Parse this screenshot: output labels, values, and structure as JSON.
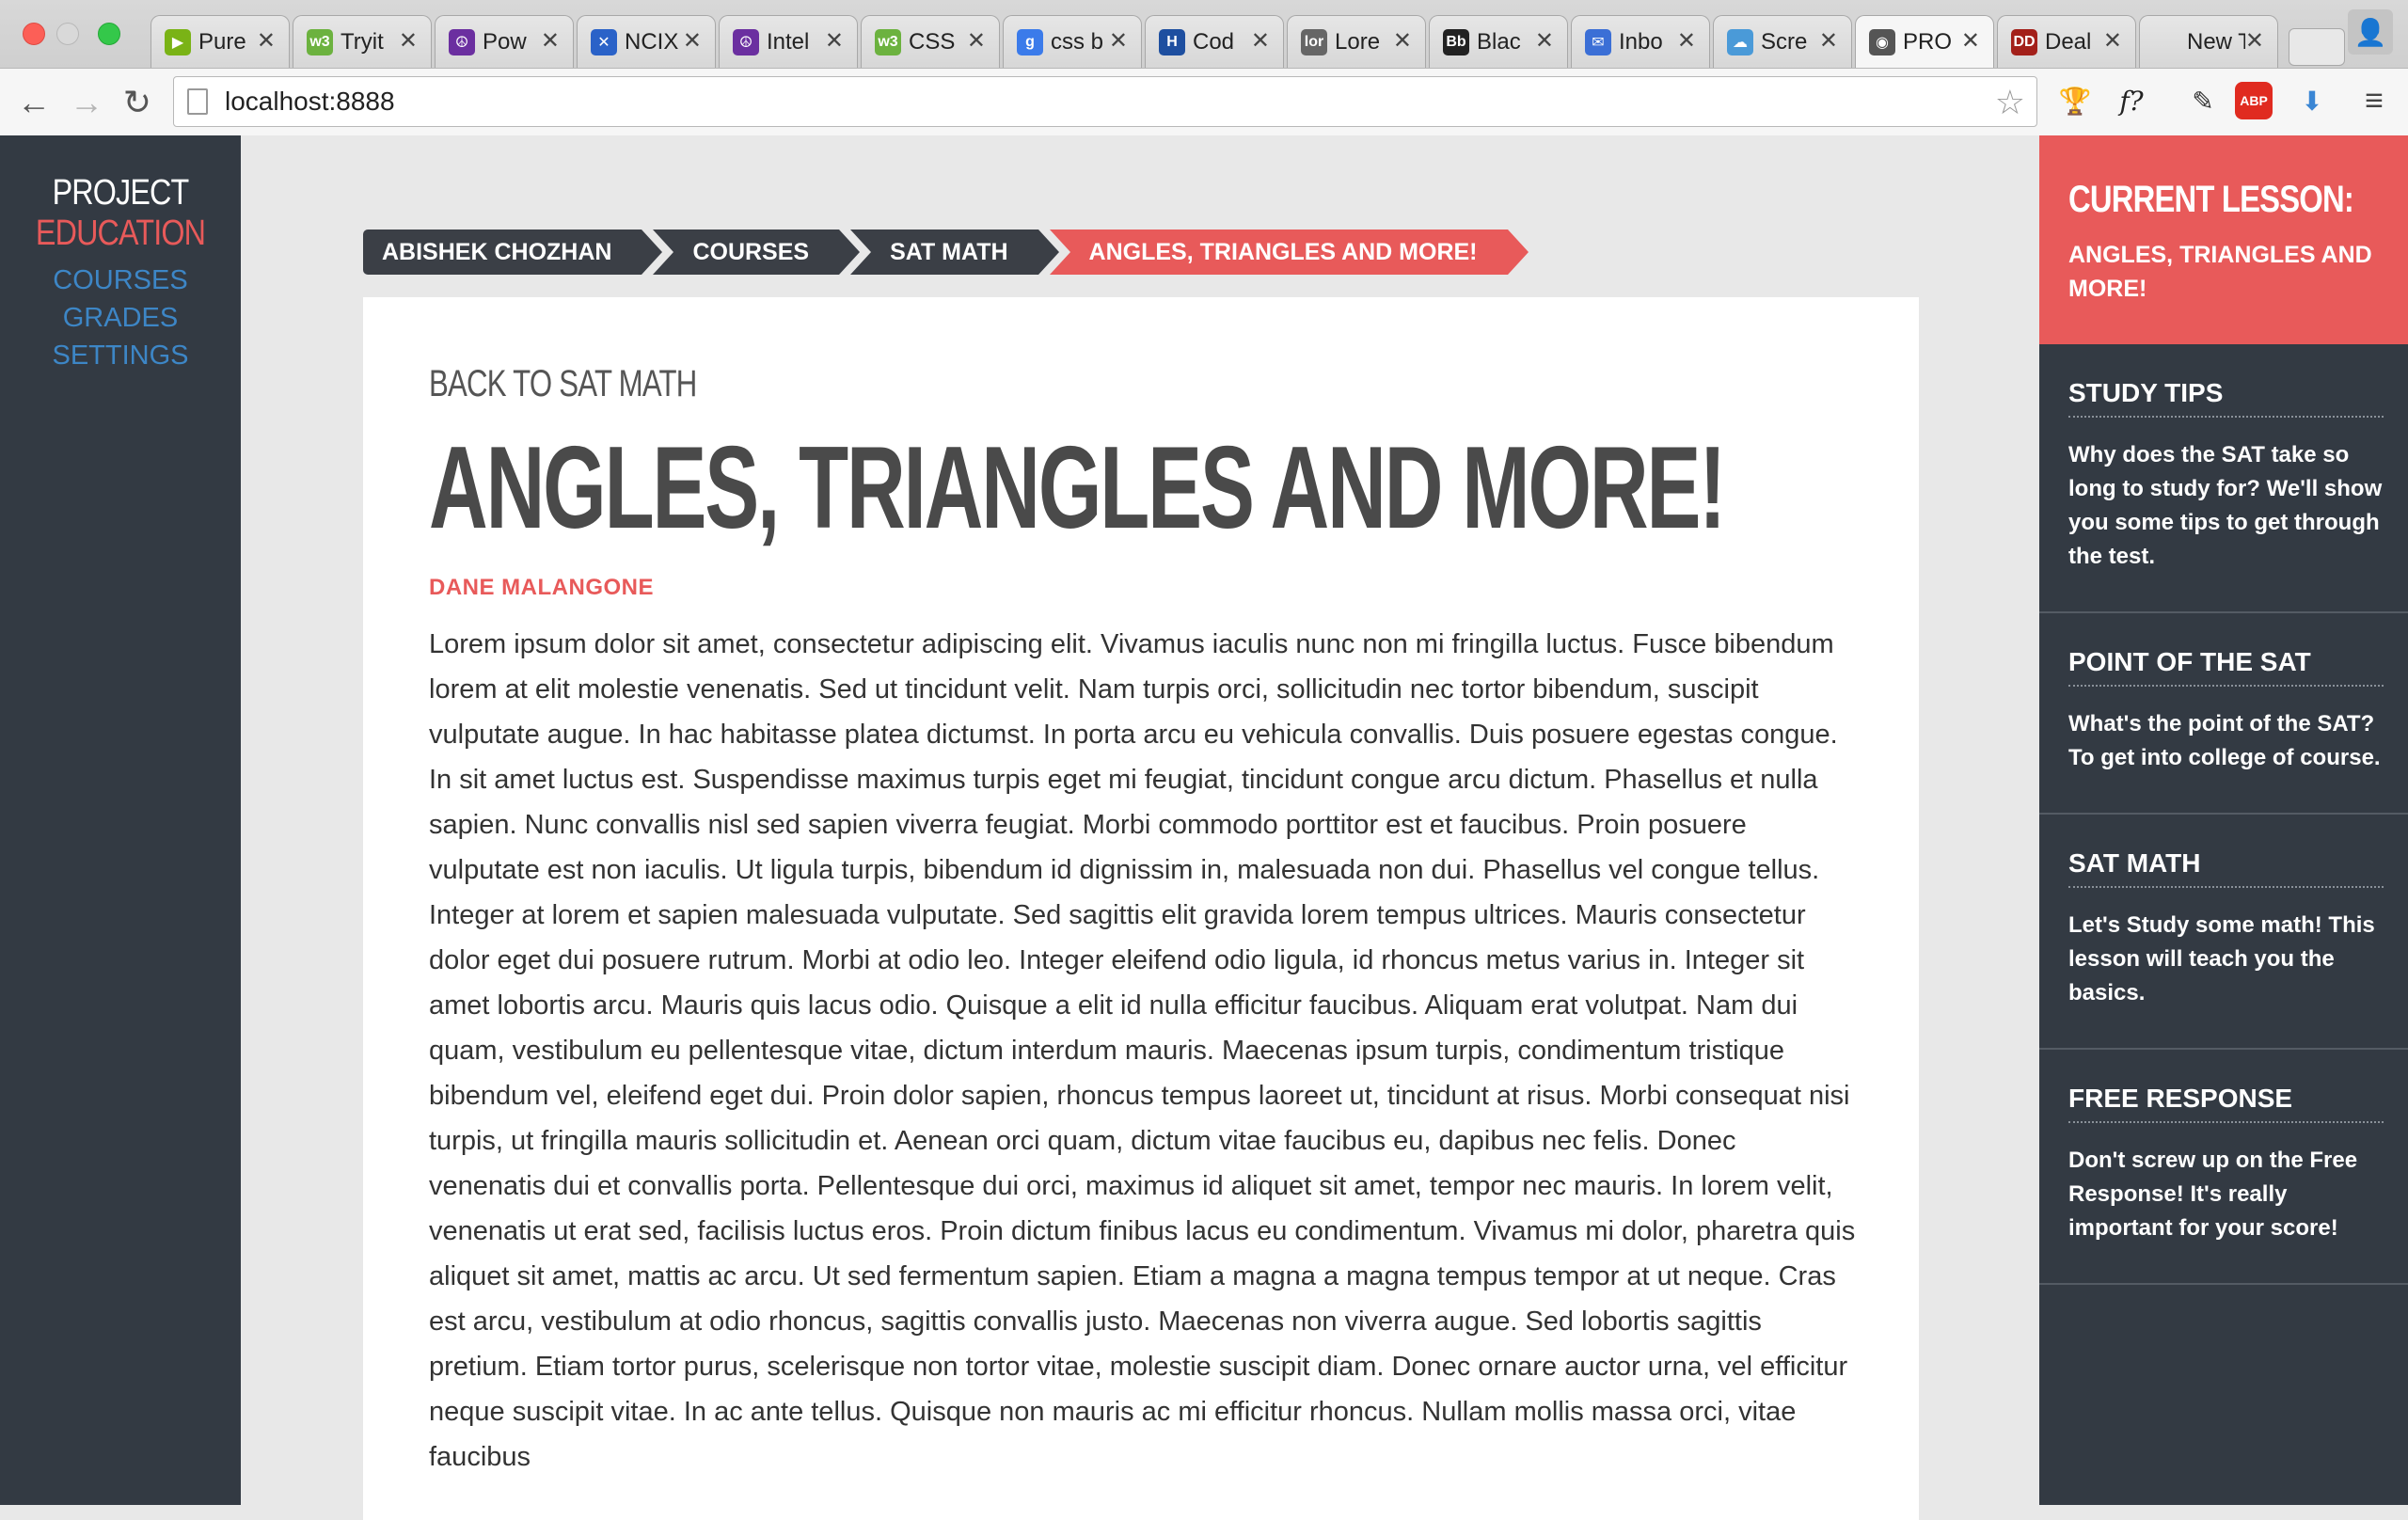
{
  "browser": {
    "tabs": [
      {
        "title": "Pure",
        "fav_text": "▶",
        "fav_color": "#7ab316"
      },
      {
        "title": "Tryit",
        "fav_text": "w3",
        "fav_color": "#6cb23f"
      },
      {
        "title": "Pow",
        "fav_text": "☮",
        "fav_color": "#6b2fa0"
      },
      {
        "title": "NCIX",
        "fav_text": "✕",
        "fav_color": "#2a62c8"
      },
      {
        "title": "Intel",
        "fav_text": "☮",
        "fav_color": "#6b2fa0"
      },
      {
        "title": "CSS",
        "fav_text": "w3",
        "fav_color": "#6cb23f"
      },
      {
        "title": "css b",
        "fav_text": "g",
        "fav_color": "#3b7bea"
      },
      {
        "title": "Cod",
        "fav_text": "H",
        "fav_color": "#1e4fa0"
      },
      {
        "title": "Lore",
        "fav_text": "lor",
        "fav_color": "#666666"
      },
      {
        "title": "Blac",
        "fav_text": "Bb",
        "fav_color": "#222222"
      },
      {
        "title": "Inbo",
        "fav_text": "✉",
        "fav_color": "#3b6fd6"
      },
      {
        "title": "Scre",
        "fav_text": "☁",
        "fav_color": "#4a9ad8"
      },
      {
        "title": "PRO",
        "fav_text": "◉",
        "fav_color": "#555555"
      },
      {
        "title": "Deal",
        "fav_text": "DD",
        "fav_color": "#a3201a"
      },
      {
        "title": "New Ta",
        "fav_text": "",
        "fav_color": "transparent"
      }
    ],
    "tab_close": "✕",
    "url": "localhost:8888",
    "active_tab_index": 12
  },
  "nav": {
    "logo_line1": "PROJECT",
    "logo_line2": "EDUCATION",
    "links": [
      "COURSES",
      "GRADES",
      "SETTINGS"
    ]
  },
  "breadcrumb": [
    "ABISHEK CHOZHAN",
    "COURSES",
    "SAT MATH",
    "ANGLES, TRIANGLES AND MORE!"
  ],
  "lesson": {
    "back_link": "BACK TO SAT MATH",
    "title": "ANGLES, TRIANGLES AND MORE!",
    "author": "DANE MALANGONE",
    "body": "Lorem ipsum dolor sit amet, consectetur adipiscing elit. Vivamus iaculis nunc non mi fringilla luctus. Fusce bibendum lorem at elit molestie venenatis. Sed ut tincidunt velit. Nam turpis orci, sollicitudin nec tortor bibendum, suscipit vulputate augue. In hac habitasse platea dictumst. In porta arcu eu vehicula convallis. Duis posuere egestas congue. In sit amet luctus est. Suspendisse maximus turpis eget mi feugiat, tincidunt congue arcu dictum. Phasellus et nulla sapien. Nunc convallis nisl sed sapien viverra feugiat. Morbi commodo porttitor est et faucibus. Proin posuere vulputate est non iaculis. Ut ligula turpis, bibendum id dignissim in, malesuada non dui. Phasellus vel congue tellus. Integer at lorem et sapien malesuada vulputate. Sed sagittis elit gravida lorem tempus ultrices. Mauris consectetur dolor eget dui posuere rutrum. Morbi at odio leo. Integer eleifend odio ligula, id rhoncus metus varius in. Integer sit amet lobortis arcu. Mauris quis lacus odio. Quisque a elit id nulla efficitur faucibus. Aliquam erat volutpat. Nam dui quam, vestibulum eu pellentesque vitae, dictum interdum mauris. Maecenas ipsum turpis, condimentum tristique bibendum vel, eleifend eget dui. Proin dolor sapien, rhoncus tempus laoreet ut, tincidunt at risus. Morbi consequat nisi turpis, ut fringilla mauris sollicitudin et. Aenean orci quam, dictum vitae faucibus eu, dapibus nec felis. Donec venenatis dui et convallis porta. Pellentesque dui orci, maximus id aliquet sit amet, tempor nec mauris. In lorem velit, venenatis ut erat sed, facilisis luctus eros. Proin dictum finibus lacus eu condimentum. Vivamus mi dolor, pharetra quis aliquet sit amet, mattis ac arcu. Ut sed fermentum sapien. Etiam a magna a magna tempus tempor at ut neque. Cras est arcu, vestibulum at odio rhoncus, sagittis convallis justo. Maecenas non viverra augue. Sed lobortis sagittis pretium. Etiam tortor purus, scelerisque non tortor vitae, molestie suscipit diam. Donec ornare auctor urna, vel efficitur neque suscipit vitae. In ac ante tellus. Quisque non mauris ac mi efficitur rhoncus. Nullam mollis massa orci, vitae faucibus"
  },
  "sidebar": {
    "current_heading": "CURRENT LESSON:",
    "current_title": "ANGLES, TRIANGLES AND MORE!",
    "items": [
      {
        "title": "STUDY TIPS",
        "desc": "Why does the SAT take so long to study for? We'll show you some tips to get through the test."
      },
      {
        "title": "POINT OF THE SAT",
        "desc": "What's the point of the SAT? To get into college of course."
      },
      {
        "title": "SAT MATH",
        "desc": "Let's Study some math! This lesson will teach you the basics."
      },
      {
        "title": "FREE RESPONSE",
        "desc": "Don't screw up on the Free Response! It's really important for your score!"
      }
    ]
  },
  "colors": {
    "accent": "#e85a5a",
    "dark": "#333a43",
    "link": "#3d86c6"
  }
}
